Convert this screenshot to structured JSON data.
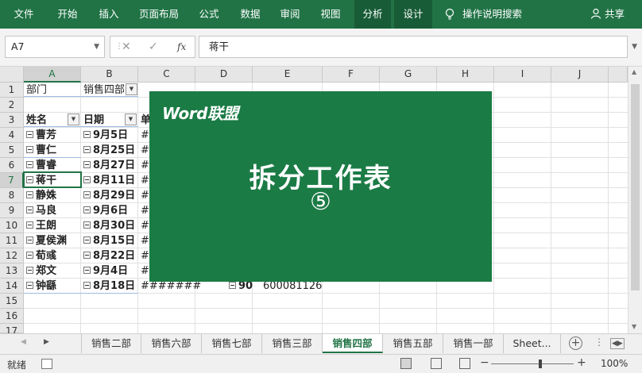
{
  "ribbon": {
    "tabs": [
      "文件",
      "开始",
      "插入",
      "页面布局",
      "公式",
      "数据",
      "审阅",
      "视图",
      "分析",
      "设计"
    ],
    "search_label": "操作说明搜索",
    "share_label": "共享",
    "accent": "#217346"
  },
  "formula_bar": {
    "name_box": "A7",
    "fx_label": "fx",
    "content": "蒋干"
  },
  "columns": [
    "A",
    "B",
    "C",
    "D",
    "E",
    "F",
    "G",
    "H",
    "I",
    "J"
  ],
  "rows": [
    "1",
    "2",
    "3",
    "4",
    "5",
    "6",
    "7",
    "8",
    "9",
    "10",
    "11",
    "12",
    "13",
    "14",
    "15",
    "16",
    "17"
  ],
  "sheet": {
    "a1": "部门",
    "b1": "销售四部",
    "a3": "姓名",
    "b3": "日期",
    "c3": "单",
    "records": [
      {
        "name": "曹芳",
        "date": "9月5日",
        "c": "#"
      },
      {
        "name": "曹仁",
        "date": "8月25日",
        "c": "#"
      },
      {
        "name": "曹睿",
        "date": "8月27日",
        "c": "#"
      },
      {
        "name": "蒋干",
        "date": "8月11日",
        "c": "#"
      },
      {
        "name": "静姝",
        "date": "8月29日",
        "c": "#"
      },
      {
        "name": "马良",
        "date": "9月6日",
        "c": "#"
      },
      {
        "name": "王朗",
        "date": "8月30日",
        "c": "#"
      },
      {
        "name": "夏侯渊",
        "date": "8月15日",
        "c": "#"
      },
      {
        "name": "荀彧",
        "date": "8月22日",
        "c": "#"
      },
      {
        "name": "郑文",
        "date": "9月4日",
        "c": "#"
      },
      {
        "name": "钟繇",
        "date": "8月18日",
        "c": "#######",
        "d": "90",
        "e": "600081126"
      }
    ]
  },
  "overlay": {
    "logo": "Word联盟",
    "title": "拆分工作表",
    "number": "⑤",
    "color": "#1b7b45"
  },
  "sheet_tabs": [
    "销售二部",
    "销售六部",
    "销售七部",
    "销售三部",
    "销售四部",
    "销售五部",
    "销售一部",
    "Sheet..."
  ],
  "active_sheet": "销售四部",
  "status": {
    "ready": "就绪",
    "zoom": "100%"
  }
}
